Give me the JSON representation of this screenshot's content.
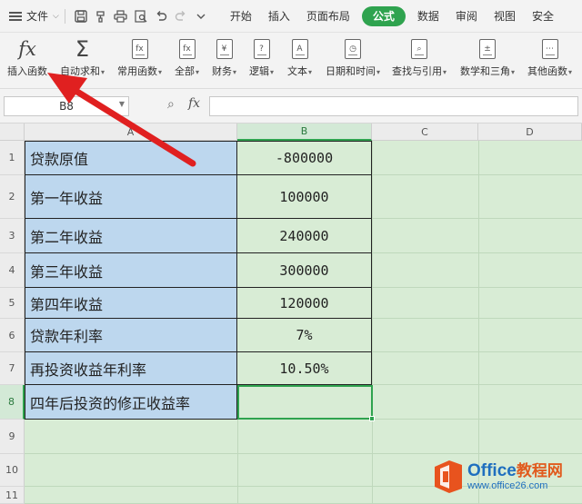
{
  "menubar": {
    "file_label": "文件",
    "tabs": [
      "开始",
      "插入",
      "页面布局",
      "公式",
      "数据",
      "审阅",
      "视图",
      "安全"
    ],
    "active_tab": "公式"
  },
  "ribbon": {
    "buttons": [
      {
        "label": "插入函数",
        "icon": "fx-icon"
      },
      {
        "label": "自动求和",
        "icon": "sigma-icon"
      },
      {
        "label": "常用函数",
        "icon": "star-fx-icon"
      },
      {
        "label": "全部",
        "icon": "all-fx-icon"
      },
      {
        "label": "财务",
        "icon": "yen-icon"
      },
      {
        "label": "逻辑",
        "icon": "question-icon"
      },
      {
        "label": "文本",
        "icon": "text-a-icon"
      },
      {
        "label": "日期和时间",
        "icon": "clock-icon"
      },
      {
        "label": "查找与引用",
        "icon": "magnifier-icon"
      },
      {
        "label": "数学和三角",
        "icon": "plus-minus-icon"
      },
      {
        "label": "其他函数",
        "icon": "more-dots-icon"
      }
    ]
  },
  "formula_bar": {
    "name_box": "B8",
    "fx_symbol": "fx",
    "formula": ""
  },
  "grid": {
    "columns": [
      "A",
      "B",
      "C",
      "D"
    ],
    "selected_column": "B",
    "row_numbers": [
      "1",
      "2",
      "3",
      "4",
      "5",
      "6",
      "7",
      "8",
      "9",
      "10",
      "11"
    ],
    "selected_row": "8",
    "rows": [
      {
        "label": "贷款原值",
        "value": "-800000"
      },
      {
        "label": "第一年收益",
        "value": "100000"
      },
      {
        "label": "第二年收益",
        "value": "240000"
      },
      {
        "label": "第三年收益",
        "value": "300000"
      },
      {
        "label": "第四年收益",
        "value": "120000"
      },
      {
        "label": "贷款年利率",
        "value": "7%"
      },
      {
        "label": "再投资收益年利率",
        "value": "10.50%"
      },
      {
        "label": "四年后投资的修正收益率",
        "value": ""
      }
    ]
  },
  "watermark": {
    "brand": "Office",
    "brand_cn": "教程网",
    "url": "www.office26.com"
  },
  "colors": {
    "accent_green": "#2fa34f",
    "label_fill": "#bdd7ee",
    "sheet_fill": "#d8ecd5",
    "arrow_red": "#e02020"
  }
}
